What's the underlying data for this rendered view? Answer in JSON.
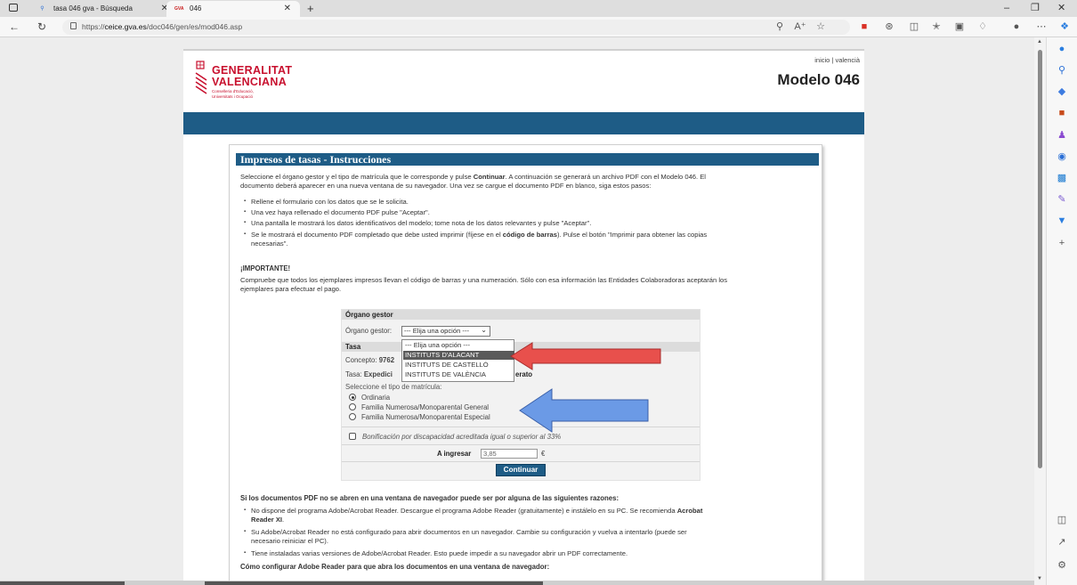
{
  "browser": {
    "tabs": [
      {
        "title": "tasa 046 gva - Búsqueda"
      },
      {
        "title": "046",
        "icon_text": "GVA"
      }
    ],
    "url_prefix": "https://",
    "url_host": "ceice.gva.es",
    "url_path": "/doc046/gen/es/mod046.asp"
  },
  "header": {
    "org_line1": "GENERALITAT",
    "org_line2": "VALENCIANA",
    "org_sub1": "Conselleria d'Educació,",
    "org_sub2": "Universitats i Ocupació",
    "link_inicio": "inicio",
    "link_sep": "|",
    "link_valencia": "valencià",
    "title": "Modelo 046"
  },
  "content": {
    "heading": "Impresos de tasas - Instrucciones",
    "intro_1a": "Seleccione el órgano gestor y el tipo de matrícula que le corresponde y pulse ",
    "intro_1b": "Continuar",
    "intro_1c": ". A continuación se generará un archivo PDF con el Modelo 046. El",
    "intro_2": "documento deberá aparecer en una nueva ventana de su navegador. Una vez se cargue el documento PDF en blanco, siga estos pasos:",
    "steps": [
      "Rellene el formulario con los datos que se le solicita.",
      "Una vez haya rellenado el documento PDF pulse \"Aceptar\".",
      "Una pantalla le mostrará los datos identificativos del modelo; tome nota de los datos relevantes y pulse \"Aceptar\"."
    ],
    "step4a": "Se le mostrará el documento PDF completado que debe usted imprimir (fíjese en el ",
    "step4b": "código de barras",
    "step4c": "). Pulse el botón \"Imprimir para obtener las copias",
    "step4d": "necesarias\".",
    "important_title": "¡IMPORTANTE!",
    "important_1": "Compruebe que todos los ejemplares impresos llevan el código de barras y una numeración. Sólo con esa información las Entidades Colaboradoras aceptarán los",
    "important_2": "ejemplares para efectuar el pago."
  },
  "form": {
    "section_organo": "Órgano gestor",
    "organo_label": "Órgano gestor:",
    "organo_selected": "--- Elija una opción ---",
    "organo_options": [
      "--- Elija una opción ---",
      "INSTITUTS D'ALACANT",
      "INSTITUTS DE CASTELLÓ",
      "INSTITUTS DE VALÈNCIA"
    ],
    "section_tasa": "Tasa",
    "concepto_label": "Concepto:",
    "concepto_value": "9762",
    "tasa_label": "Tasa:",
    "tasa_value_a": "Expedici",
    "tasa_value_b": "erato",
    "tipo_label": "Seleccione el tipo de matrícula:",
    "tipo_options": [
      {
        "label": "Ordinaria",
        "checked": true
      },
      {
        "label": "Familia Numerosa/Monoparental General",
        "checked": false
      },
      {
        "label": "Familia Numerosa/Monoparental Especial",
        "checked": false
      }
    ],
    "discapacidad_label": "Bonificación por discapacidad acreditada igual o superior al 33%",
    "ingresar_label": "A ingresar",
    "ingresar_value": "3,85",
    "currency": "€",
    "continue_label": "Continuar"
  },
  "footer_content": {
    "reasons_title": "Si los documentos PDF no se abren en una ventana de navegador puede ser por alguna de las siguientes razones:",
    "reason1a": "No dispone del programa Adobe/Acrobat Reader. Descargue el programa Adobe Reader (gratuitamente) e instálelo en su PC. Se recomienda ",
    "reason1b": "Acrobat",
    "reason1c": "Reader XI",
    "reason1d": ".",
    "reason2a": "Su Adobe/Acrobat Reader no está configurado para abrir documentos en un navegador. Cambie su configuración y vuelva a intentarlo (puede ser",
    "reason2b": "necesario reiniciar el PC).",
    "reason3": "Tiene instaladas varias versiones de Adobe/Acrobat Reader. Esto puede impedir a su navegador abrir un PDF correctamente.",
    "config_title": "Cómo configurar Adobe Reader para que abra los documentos en una ventana de navegador:"
  },
  "colors": {
    "brand_red": "#c8102e",
    "bar_blue": "#1e5c86",
    "arrow_red": "#e04848",
    "arrow_blue": "#5a8ee0"
  },
  "icons": [
    "tab-actions-icon",
    "search-icon",
    "globe-icon",
    "close-icon",
    "plus-icon",
    "back-icon",
    "refresh-icon",
    "lock-icon",
    "zoom-icon",
    "read-aloud-icon",
    "favorite-icon",
    "extension-icon",
    "split-icon",
    "favorites-icon",
    "collections-icon",
    "profile-icon",
    "more-icon",
    "copilot-icon"
  ]
}
